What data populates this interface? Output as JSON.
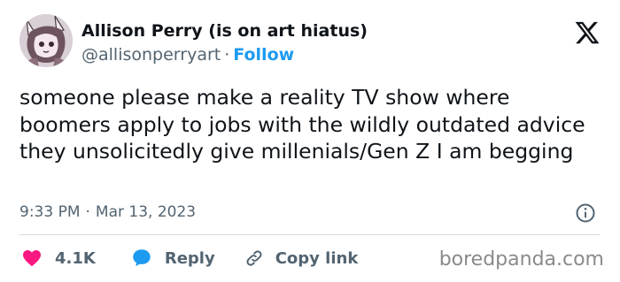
{
  "author": {
    "display_name": "Allison Perry (is on art hiatus)",
    "handle": "@allisonperryart",
    "separator": "·",
    "follow_label": "Follow"
  },
  "tweet": {
    "text": "someone please make a reality TV show where boomers apply to jobs with the wildly outdated advice they unsolicitedly give millenials/Gen Z I am begging",
    "time": "9:33 PM",
    "separator": "·",
    "date": "Mar 13, 2023"
  },
  "actions": {
    "like_count": "4.1K",
    "reply_label": "Reply",
    "copy_link_label": "Copy link"
  },
  "watermark": "boredpanda.com",
  "colors": {
    "like": "#f91880",
    "reply": "#1d9bf0",
    "link": "#1d9bf0",
    "muted": "#536471",
    "text": "#0f1419"
  },
  "icons": {
    "platform_logo": "x-logo-icon",
    "info": "info-icon",
    "like": "heart-icon",
    "reply": "speech-bubble-icon",
    "copy": "link-icon"
  }
}
